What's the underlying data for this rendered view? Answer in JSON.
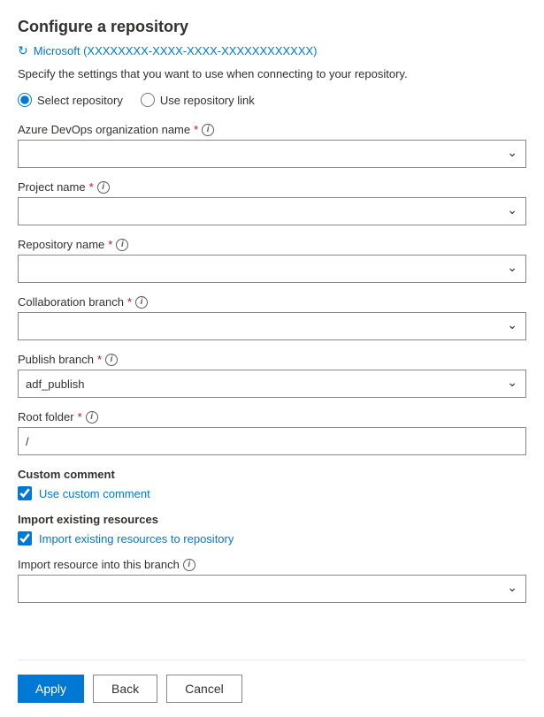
{
  "page": {
    "title": "Configure a repository",
    "account": "Microsoft (XXXXXXXX-XXXX-XXXX-XXXXXXXXXXXX)",
    "description": "Specify the settings that you want to use when connecting to your repository."
  },
  "radio": {
    "option1_label": "Select repository",
    "option2_label": "Use repository link",
    "selected": "select"
  },
  "fields": {
    "org_name_label": "Azure DevOps organization name",
    "org_name_value": "",
    "project_name_label": "Project name",
    "project_name_value": "",
    "repo_name_label": "Repository name",
    "repo_name_value": "",
    "collab_branch_label": "Collaboration branch",
    "collab_branch_value": "",
    "publish_branch_label": "Publish branch",
    "publish_branch_value": "adf_publish",
    "root_folder_label": "Root folder",
    "root_folder_value": "/",
    "import_branch_label": "Import resource into this branch",
    "import_branch_value": ""
  },
  "custom_comment": {
    "section_label": "Custom comment",
    "checkbox_label": "Use custom comment",
    "checked": true
  },
  "import_existing": {
    "section_label": "Import existing resources",
    "checkbox_label": "Import existing resources to repository",
    "checked": true
  },
  "footer": {
    "apply_label": "Apply",
    "back_label": "Back",
    "cancel_label": "Cancel"
  }
}
